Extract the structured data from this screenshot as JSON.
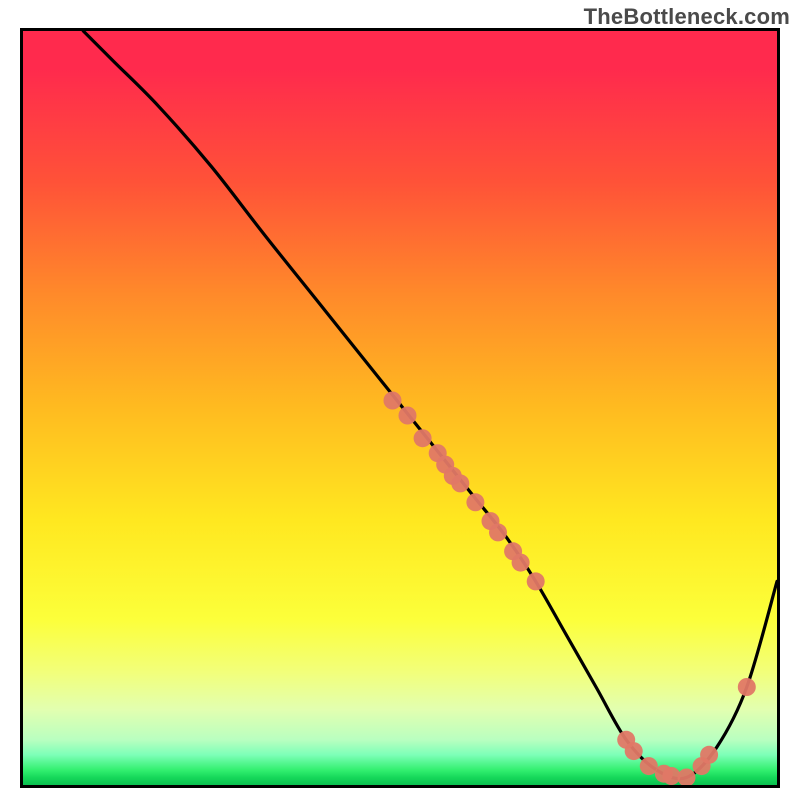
{
  "watermark": "TheBottleneck.com",
  "chart_data": {
    "type": "line",
    "title": "",
    "xlabel": "",
    "ylabel": "",
    "xlim": [
      0,
      100
    ],
    "ylim": [
      0,
      100
    ],
    "series": [
      {
        "name": "curve",
        "x": [
          8,
          12,
          18,
          25,
          32,
          40,
          48,
          52,
          56,
          60,
          64,
          68,
          72,
          76,
          80,
          84,
          88,
          92,
          96,
          100
        ],
        "y": [
          100,
          96,
          90,
          82,
          73,
          63,
          53,
          48,
          43,
          38,
          33,
          27,
          20,
          13,
          6,
          2,
          1,
          5,
          13,
          27
        ]
      }
    ],
    "markers": {
      "name": "data-points",
      "color": "#e07866",
      "points": [
        {
          "x": 49,
          "y": 51
        },
        {
          "x": 51,
          "y": 49
        },
        {
          "x": 53,
          "y": 46
        },
        {
          "x": 55,
          "y": 44
        },
        {
          "x": 56,
          "y": 42.5
        },
        {
          "x": 57,
          "y": 41
        },
        {
          "x": 58,
          "y": 40
        },
        {
          "x": 60,
          "y": 37.5
        },
        {
          "x": 62,
          "y": 35
        },
        {
          "x": 63,
          "y": 33.5
        },
        {
          "x": 65,
          "y": 31
        },
        {
          "x": 66,
          "y": 29.5
        },
        {
          "x": 68,
          "y": 27
        },
        {
          "x": 80,
          "y": 6
        },
        {
          "x": 81,
          "y": 4.5
        },
        {
          "x": 83,
          "y": 2.5
        },
        {
          "x": 85,
          "y": 1.5
        },
        {
          "x": 86,
          "y": 1.2
        },
        {
          "x": 88,
          "y": 1
        },
        {
          "x": 90,
          "y": 2.5
        },
        {
          "x": 91,
          "y": 4
        },
        {
          "x": 96,
          "y": 13
        }
      ]
    },
    "gradient_stops": [
      {
        "offset": 0,
        "color": "#ff2a4d"
      },
      {
        "offset": 5,
        "color": "#ff2a4d"
      },
      {
        "offset": 20,
        "color": "#ff5238"
      },
      {
        "offset": 35,
        "color": "#ff8a2a"
      },
      {
        "offset": 50,
        "color": "#ffbb20"
      },
      {
        "offset": 65,
        "color": "#ffe820"
      },
      {
        "offset": 78,
        "color": "#fcff3a"
      },
      {
        "offset": 85,
        "color": "#f2ff7a"
      },
      {
        "offset": 90,
        "color": "#e2ffb0"
      },
      {
        "offset": 94,
        "color": "#b9ffc0"
      },
      {
        "offset": 96,
        "color": "#7dffb8"
      },
      {
        "offset": 98,
        "color": "#33f070"
      },
      {
        "offset": 99,
        "color": "#16d85a"
      },
      {
        "offset": 100,
        "color": "#0ac050"
      }
    ]
  }
}
